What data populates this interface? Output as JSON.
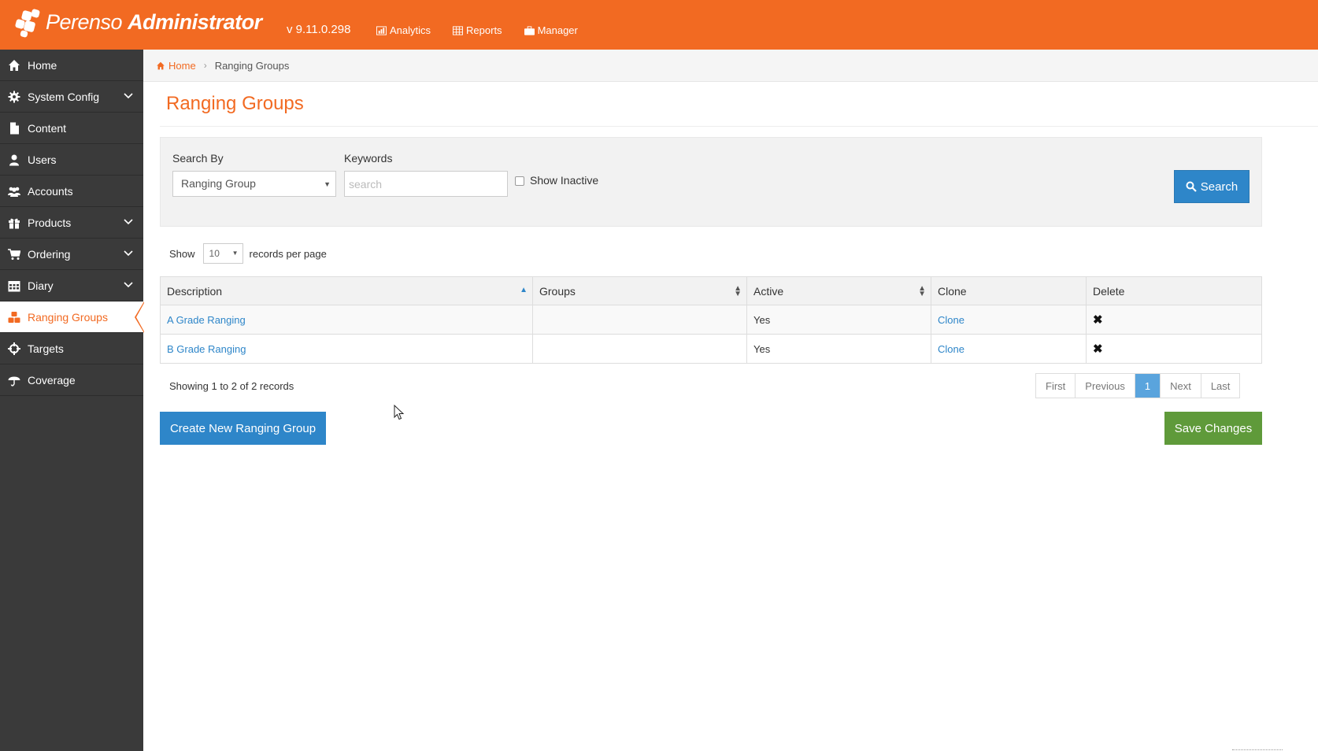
{
  "header": {
    "brand_light": "Perenso",
    "brand_bold": "Administrator",
    "version": "v 9.11.0.298",
    "nav": [
      {
        "label": "Analytics",
        "icon": "chart-icon"
      },
      {
        "label": "Reports",
        "icon": "table-icon"
      },
      {
        "label": "Manager",
        "icon": "briefcase-icon"
      }
    ]
  },
  "sidebar": {
    "items": [
      {
        "label": "Home",
        "icon": "home-icon",
        "expandable": false
      },
      {
        "label": "System Config",
        "icon": "gear-icon",
        "expandable": true
      },
      {
        "label": "Content",
        "icon": "document-icon",
        "expandable": false
      },
      {
        "label": "Users",
        "icon": "user-icon",
        "expandable": false
      },
      {
        "label": "Accounts",
        "icon": "group-icon",
        "expandable": false
      },
      {
        "label": "Products",
        "icon": "gift-icon",
        "expandable": true
      },
      {
        "label": "Ordering",
        "icon": "cart-icon",
        "expandable": true
      },
      {
        "label": "Diary",
        "icon": "calendar-icon",
        "expandable": true
      },
      {
        "label": "Ranging Groups",
        "icon": "cubes-icon",
        "expandable": false,
        "active": true
      },
      {
        "label": "Targets",
        "icon": "crosshairs-icon",
        "expandable": false
      },
      {
        "label": "Coverage",
        "icon": "umbrella-icon",
        "expandable": false
      }
    ]
  },
  "breadcrumb": {
    "home": "Home",
    "current": "Ranging Groups"
  },
  "page": {
    "title": "Ranging Groups"
  },
  "search": {
    "search_by_label": "Search By",
    "search_by_value": "Ranging Group",
    "keywords_label": "Keywords",
    "keywords_placeholder": "search",
    "keywords_value": "",
    "show_inactive_label": "Show Inactive",
    "show_inactive_checked": false,
    "button_label": "Search"
  },
  "paging": {
    "show_label": "Show",
    "per_page_value": "10",
    "per_page_suffix": "records per page",
    "summary": "Showing 1 to 2 of 2 records",
    "buttons": [
      "First",
      "Previous",
      "1",
      "Next",
      "Last"
    ],
    "current_page": "1"
  },
  "table": {
    "columns": [
      "Description",
      "Groups",
      "Active",
      "Clone",
      "Delete"
    ],
    "rows": [
      {
        "description": "A Grade Ranging",
        "groups": "",
        "active": "Yes",
        "clone": "Clone",
        "delete": "✖"
      },
      {
        "description": "B Grade Ranging",
        "groups": "",
        "active": "Yes",
        "clone": "Clone",
        "delete": "✖"
      }
    ]
  },
  "actions": {
    "create_label": "Create New Ranging Group",
    "save_label": "Save Changes"
  },
  "colors": {
    "brand_orange": "#f26a22",
    "sidebar_bg": "#3a3a3a",
    "primary_blue": "#2e86c9",
    "save_green": "#5f9a3a"
  }
}
